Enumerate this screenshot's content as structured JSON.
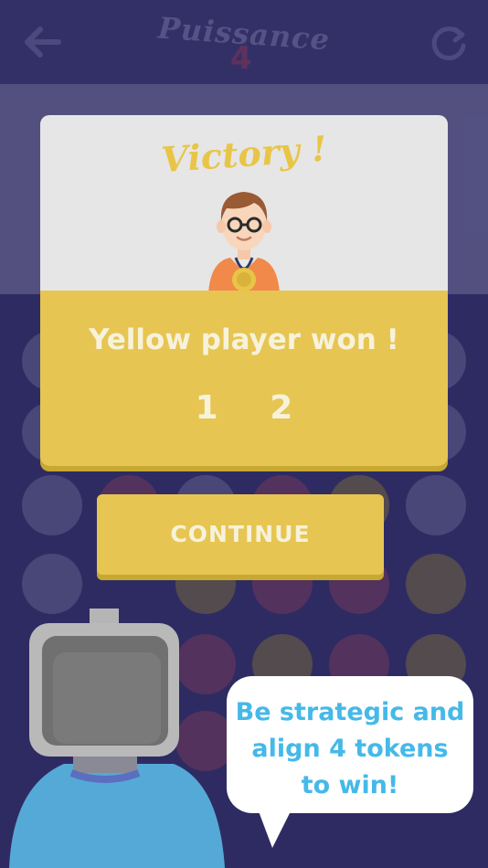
{
  "header": {
    "logo_word": "Puissance",
    "logo_number": "4",
    "back_icon": "back-arrow-icon",
    "restart_icon": "restart-icon"
  },
  "modal": {
    "title": "Victory !",
    "message": "Yellow player won !",
    "scores": [
      "1",
      "2"
    ],
    "avatar_icon": "player-avatar-with-medal"
  },
  "continue_label": "CONTINUE",
  "tip": {
    "text": "Be strategic and align 4 tokens to win!",
    "line1": "Be strategic and",
    "line2": "align 4 tokens",
    "line3": "to win!"
  },
  "colors": {
    "background": "#3a3770",
    "yellow_accent": "#e7c552",
    "tip_text": "#45b9e8"
  }
}
